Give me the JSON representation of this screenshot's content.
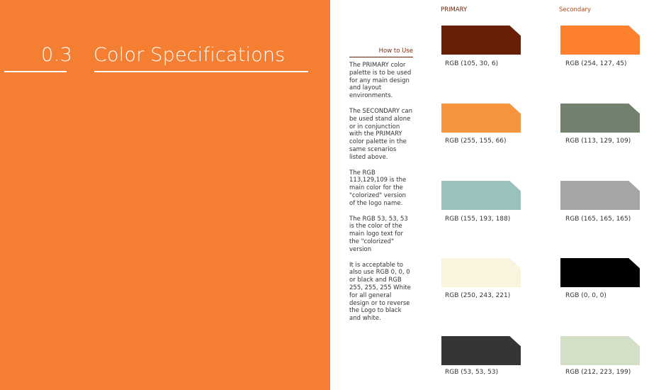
{
  "section": {
    "number": "0.3",
    "title": "Color Specifications"
  },
  "how_to_use": {
    "heading": "How to Use",
    "paragraphs": [
      "The PRIMARY color palette is to be used for any main design and layout environments.",
      "The SECONDARY can be used stand alone or in conjunction with the PRIMARY color palette in the same scenarios listed above.",
      "The RGB 113,129,109 is the main color for the \"colorized\" version of the logo name.",
      "The RGB 53, 53, 53 is the color of the main logo text for the \"colorized\" version",
      "It is acceptable to also use RGB 0, 0, 0 or black and RGB 255, 255, 255 White for all general design or to reverse the Logo to black and white."
    ]
  },
  "columns": {
    "primary": "PRIMARY",
    "secondary": "Secondary"
  },
  "swatches": {
    "primary": [
      {
        "label": "RGB (105, 30, 6)",
        "color": "#691e06"
      },
      {
        "label": "RGB (255, 155, 66)",
        "color": "#f7953e"
      },
      {
        "label": "RGB (155, 193, 188)",
        "color": "#9bc1bc"
      },
      {
        "label": "RGB (250, 243, 221)",
        "color": "#faf3dd"
      },
      {
        "label": "RGB (53, 53, 53)",
        "color": "#353535"
      }
    ],
    "secondary": [
      {
        "label": "RGB (254, 127, 45)",
        "color": "#fe7f2d"
      },
      {
        "label": "RGB (113, 129, 109)",
        "color": "#71816d"
      },
      {
        "label": "RGB (165, 165, 165)",
        "color": "#a5a5a5"
      },
      {
        "label": "RGB (0, 0, 0)",
        "color": "#000000"
      },
      {
        "label": "RGB (212, 223, 199)",
        "color": "#d4dfc7"
      }
    ]
  },
  "colors": {
    "panel": "#f47f33",
    "accent_dark": "#6b1e08"
  }
}
